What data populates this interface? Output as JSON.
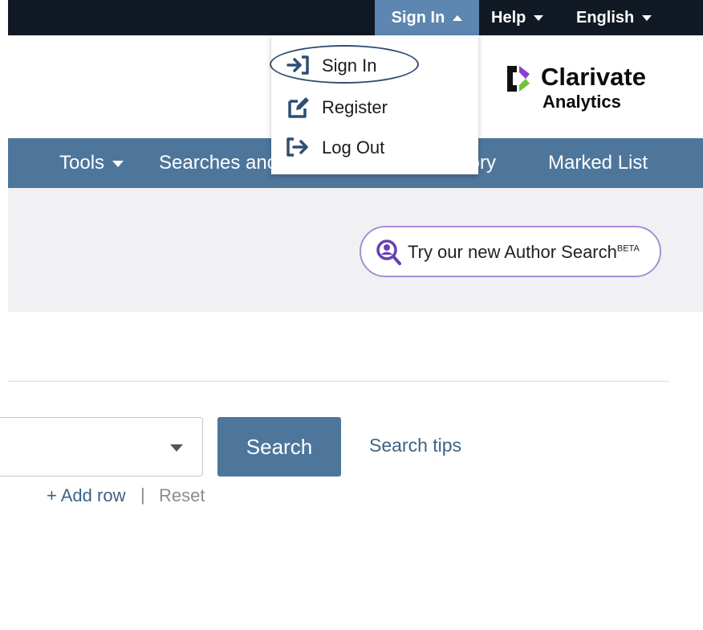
{
  "topbar": {
    "signin_label": "Sign In",
    "help_label": "Help",
    "language_label": "English"
  },
  "signin_menu": {
    "items": [
      {
        "label": "Sign In",
        "icon": "sign-in-icon"
      },
      {
        "label": "Register",
        "icon": "edit-icon"
      },
      {
        "label": "Log Out",
        "icon": "sign-out-icon"
      }
    ]
  },
  "logo": {
    "name": "Clarivate",
    "sub": "Analytics"
  },
  "nav": {
    "tools_label": "Tools",
    "searches_label": "Searches and",
    "history_label": "story",
    "marked_list_label": "Marked List"
  },
  "author_search": {
    "label": "Try our new Author Search",
    "badge": "BETA"
  },
  "search": {
    "button_label": "Search",
    "tips_label": "Search tips",
    "add_row_label": "+ Add row",
    "separator": "|",
    "reset_label": "Reset"
  },
  "colors": {
    "topbar": "#111a24",
    "signin_active": "#5d86b0",
    "nav": "#4e769b",
    "band": "#f1f1f3",
    "accent_purple": "#6a3fb5",
    "link": "#3d6384"
  }
}
